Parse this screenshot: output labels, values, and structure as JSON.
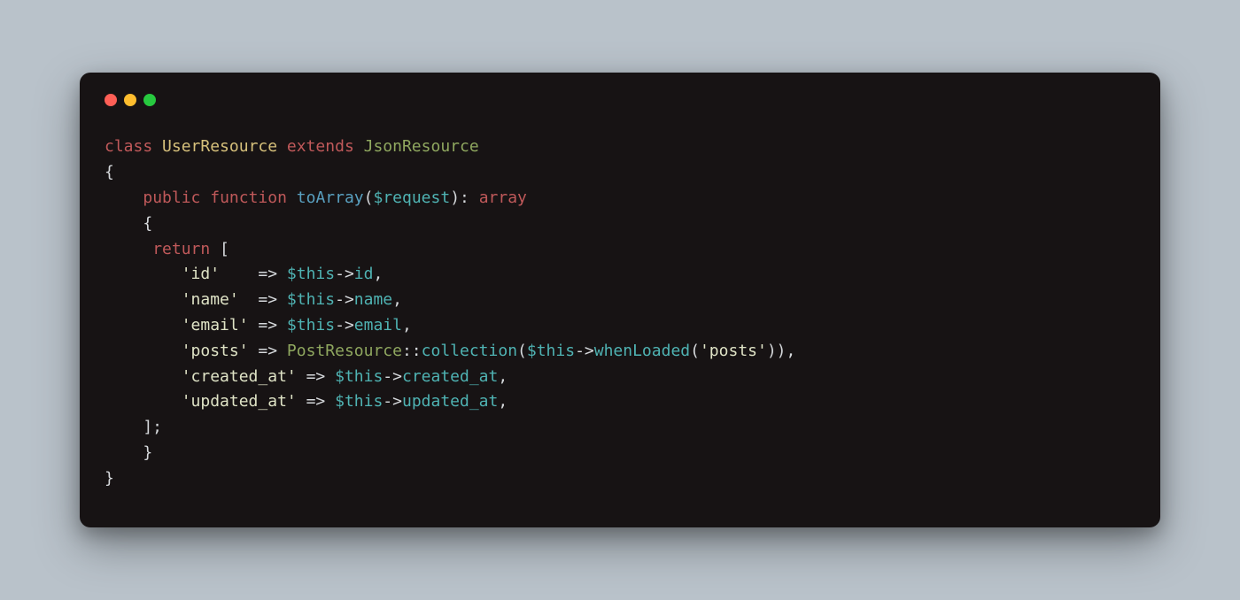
{
  "code": {
    "l1": {
      "t1": "class",
      "t2": " ",
      "t3": "UserResource",
      "t4": " ",
      "t5": "extends",
      "t6": " ",
      "t7": "JsonResource"
    },
    "l2": {
      "t1": "{"
    },
    "l3": {
      "t1": "    ",
      "t2": "public",
      "t3": " ",
      "t4": "function",
      "t5": " ",
      "t6": "toArray",
      "t7": "(",
      "t8": "$request",
      "t9": "): ",
      "t10": "array"
    },
    "l4": {
      "t1": "    {"
    },
    "l5": {
      "t1": "     ",
      "t2": "return",
      "t3": " ["
    },
    "l6": {
      "t1": "        ",
      "t2": "'id'",
      "t3": "    => ",
      "t4": "$this",
      "t5": "->",
      "t6": "id",
      "t7": ","
    },
    "l7": {
      "t1": "        ",
      "t2": "'name'",
      "t3": "  => ",
      "t4": "$this",
      "t5": "->",
      "t6": "name",
      "t7": ","
    },
    "l8": {
      "t1": "        ",
      "t2": "'email'",
      "t3": " => ",
      "t4": "$this",
      "t5": "->",
      "t6": "email",
      "t7": ","
    },
    "l9": {
      "t1": "        ",
      "t2": "'posts'",
      "t3": " => ",
      "t4": "PostResource",
      "t5": "::",
      "t6": "collection",
      "t7": "(",
      "t8": "$this",
      "t9": "->",
      "t10": "whenLoaded",
      "t11": "(",
      "t12": "'posts'",
      "t13": ")),"
    },
    "l10": {
      "t1": "        ",
      "t2": "'created_at'",
      "t3": " => ",
      "t4": "$this",
      "t5": "->",
      "t6": "created_at",
      "t7": ","
    },
    "l11": {
      "t1": "        ",
      "t2": "'updated_at'",
      "t3": " => ",
      "t4": "$this",
      "t5": "->",
      "t6": "updated_at",
      "t7": ","
    },
    "l12": {
      "t1": "    ];"
    },
    "l13": {
      "t1": "    }"
    },
    "l14": {
      "t1": "}"
    }
  }
}
